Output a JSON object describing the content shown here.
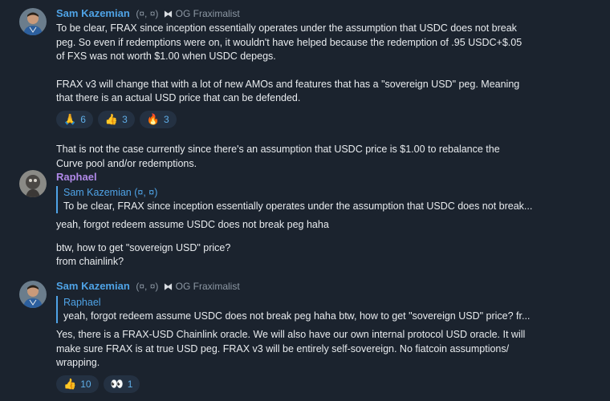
{
  "messages": [
    {
      "author": "Sam Kazemian",
      "tag": "(¤, ¤)",
      "role_icon": "⧓",
      "role": "OG Fraxim alist",
      "role_text": "OG Fraximalist",
      "paragraphs": [
        "To be clear, FRAX since inception essentially operates under the assumption that USDC does not break",
        "peg. So even if redemptions were on, it wouldn't have helped because the redemption of .95 USDC+$.05",
        "of FXS was not worth $1.00 when USDC depegs.",
        "FRAX v3 will change that with a lot of new AMOs and features that has a \"sovereign USD\" peg. Meaning",
        "that there is an actual USD price that can be defended."
      ],
      "reactions": [
        {
          "emoji": "🙏",
          "count": "6"
        },
        {
          "emoji": "👍",
          "count": "3"
        },
        {
          "emoji": "🔥",
          "count": "3"
        }
      ],
      "followup": [
        "That is not the case currently since there's an assumption that USDC price is $1.00 to rebalance the",
        "Curve pool and/or redemptions."
      ]
    },
    {
      "author": "Raphael",
      "reply_name": "Sam Kazemian (¤, ¤)",
      "reply_text": "To be clear, FRAX since inception essentially operates under the assumption that USDC does not break...",
      "line1": "yeah, forgot redeem assume USDC does not break peg haha",
      "line2": "btw, how to get \"sovereign USD\" price?",
      "line3": "from chainlink?"
    },
    {
      "author": "Sam Kazemian",
      "tag": "(¤, ¤)",
      "role_icon": "⧓",
      "role_text": "OG Fraximalist",
      "reply_name": "Raphael",
      "reply_text": "yeah, forgot redeem assume USDC does not break peg haha  btw, how to get \"sovereign USD\" price? fr...",
      "paragraphs": [
        "Yes, there is a FRAX-USD Chainlink oracle. We will also have our own internal protocol USD oracle. It will",
        "make sure FRAX is at true USD peg. FRAX v3 will be entirely self-sovereign. No fiatcoin assumptions/",
        "wrapping."
      ],
      "reactions": [
        {
          "emoji": "👍",
          "count": "10"
        },
        {
          "emoji": "👀",
          "count": "1"
        }
      ]
    }
  ]
}
